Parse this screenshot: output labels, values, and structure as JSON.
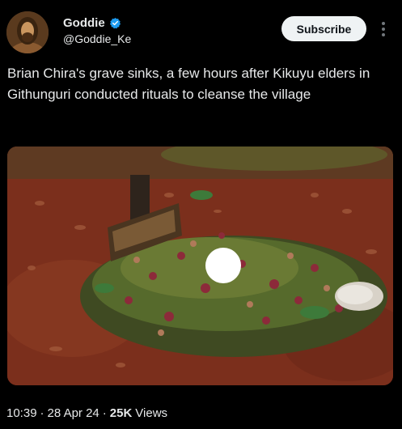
{
  "author": {
    "display_name": "Goddie",
    "handle": "@Goddie_Ke",
    "verified": true,
    "avatar_icon": "avatar-portrait"
  },
  "actions": {
    "subscribe_label": "Subscribe",
    "more_icon": "more-vertical-icon"
  },
  "tweet": {
    "text": "Brian Chira's grave sinks, a few hours after Kikuyu elders in Githunguri conducted rituals to cleanse the village"
  },
  "media": {
    "description_icon": "photo-grave"
  },
  "meta": {
    "time": "10:39",
    "separator": "·",
    "date": "28 Apr 24",
    "views_count": "25K",
    "views_label": "Views"
  },
  "colors": {
    "background": "#000000",
    "text": "#e7e9ea",
    "verified_badge": "#1d9bf0",
    "subscribe_bg": "#eff3f4"
  }
}
